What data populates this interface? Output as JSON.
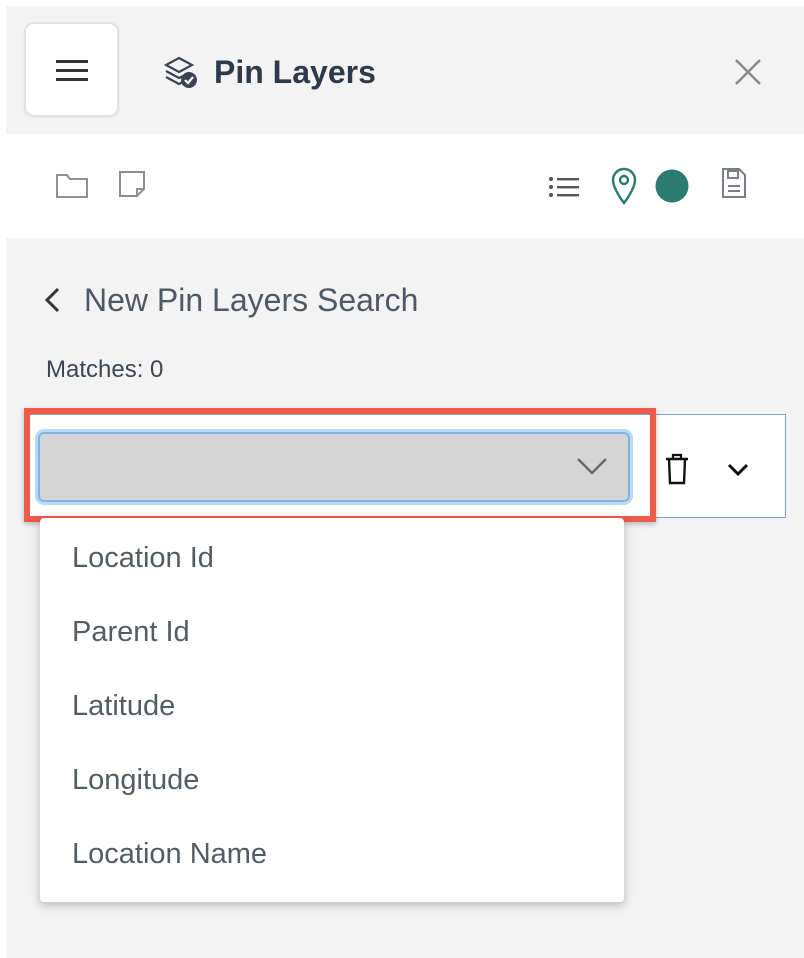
{
  "header": {
    "title": "Pin Layers",
    "menu_icon": "hamburger-icon",
    "title_icon": "layers-check-icon",
    "close_icon": "close-icon"
  },
  "toolbar": {
    "left_icons": [
      "folder-icon",
      "note-icon"
    ],
    "right_icons": [
      "list-icon",
      "map-pin-icon",
      "color-circle-icon",
      "save-icon"
    ],
    "pin_color": "#2a7c70"
  },
  "search": {
    "back_icon": "chevron-left-icon",
    "title": "New Pin Layers Search",
    "matches": "Matches: 0"
  },
  "filter": {
    "selected_value": "",
    "options": [
      "Location Id",
      "Parent Id",
      "Latitude",
      "Longitude",
      "Location Name"
    ]
  },
  "colors": {
    "highlight": "#f05a4a",
    "accent": "#2a7c70",
    "focus": "#7db5e6"
  }
}
